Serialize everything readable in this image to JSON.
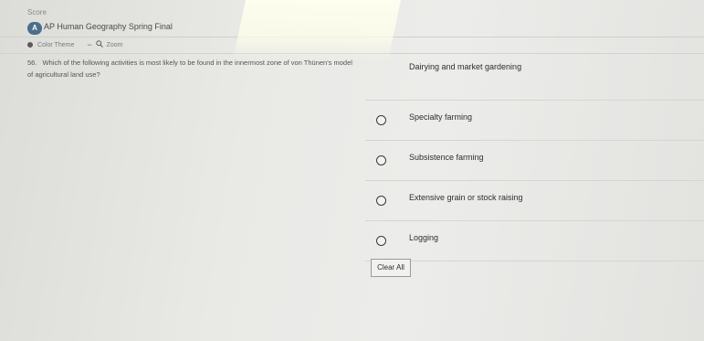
{
  "header": {
    "top_hint": "Score",
    "logo_text": "A",
    "title": "AP Human Geography Spring Final"
  },
  "toolbar": {
    "color_theme_label": "Color Theme",
    "zoom_label": "Zoom",
    "zoom_out_glyph": "−",
    "zoom_in_glyph": "⊕"
  },
  "question": {
    "number": "56.",
    "text": "Which of the following activities is most likely to be found in the innermost zone of von Thünen's model of agricultural land use?"
  },
  "choices": [
    {
      "label": "Dairying and market gardening"
    },
    {
      "label": "Specialty farming"
    },
    {
      "label": "Subsistence farming"
    },
    {
      "label": "Extensive grain or stock raising"
    },
    {
      "label": "Logging"
    }
  ],
  "actions": {
    "clear_all_label": "Clear All"
  },
  "icons": {
    "color_theme": "palette-dot-icon",
    "zoom": "magnifier-icon",
    "radio": "radio-empty-icon"
  }
}
